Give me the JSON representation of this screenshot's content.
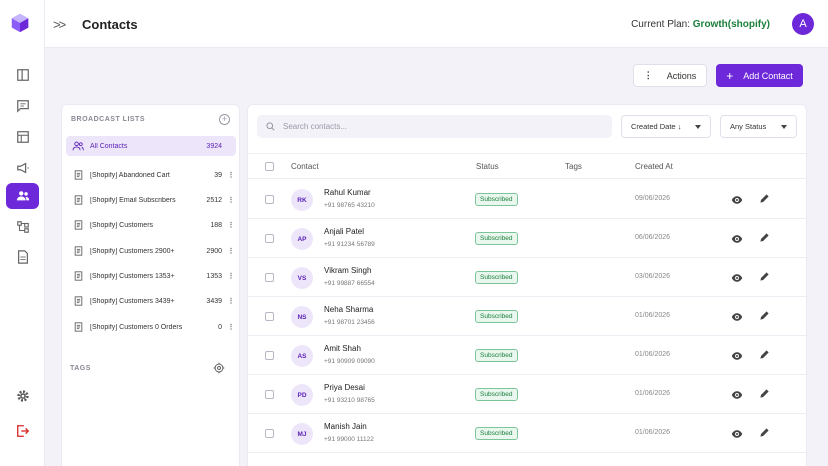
{
  "header": {
    "title": "Contacts",
    "plan_label": "Current Plan:",
    "plan_value": "Growth(shopify)",
    "avatar_initial": "A"
  },
  "toolbar": {
    "actions_label": "Actions",
    "add_contact_label": "Add Contact"
  },
  "sidebar": {
    "broadcast_header": "BROADCAST LISTS",
    "tags_header": "TAGS",
    "lists": [
      {
        "label": "All Contacts",
        "count": "3924",
        "active": true
      },
      {
        "label": "[Shopify] Abandoned Cart",
        "count": "39"
      },
      {
        "label": "[Shopify] Email Subscribers",
        "count": "2512"
      },
      {
        "label": "[Shopify] Customers",
        "count": "188"
      },
      {
        "label": "[Shopify] Customers 2900+",
        "count": "2900"
      },
      {
        "label": "[Shopify] Customers 1353+",
        "count": "1353"
      },
      {
        "label": "[Shopify] Customers 3439+",
        "count": "3439"
      },
      {
        "label": "[Shopify] Customers 0 Orders",
        "count": "0"
      }
    ]
  },
  "filters": {
    "search_placeholder": "Search contacts...",
    "sort_label": "Created Date ↓",
    "status_label": "Any Status"
  },
  "table": {
    "columns": {
      "contact": "Contact",
      "status": "Status",
      "tags": "Tags",
      "created": "Created At"
    },
    "rows": [
      {
        "initials": "RK",
        "name": "Rahul Kumar",
        "phone": "+91 98765 43210",
        "status": "Subscribed",
        "created": "09/06/2026"
      },
      {
        "initials": "AP",
        "name": "Anjali Patel",
        "phone": "+91 91234 56789",
        "status": "Subscribed",
        "created": "06/06/2026"
      },
      {
        "initials": "VS",
        "name": "Vikram Singh",
        "phone": "+91 99887 66554",
        "status": "Subscribed",
        "created": "03/06/2026"
      },
      {
        "initials": "NS",
        "name": "Neha Sharma",
        "phone": "+91 98701 23456",
        "status": "Subscribed",
        "created": "01/06/2026"
      },
      {
        "initials": "AS",
        "name": "Amit Shah",
        "phone": "+91 90909 09090",
        "status": "Subscribed",
        "created": "01/06/2026"
      },
      {
        "initials": "PD",
        "name": "Priya Desai",
        "phone": "+91 93210 98765",
        "status": "Subscribed",
        "created": "01/06/2026"
      },
      {
        "initials": "MJ",
        "name": "Manish Jain",
        "phone": "+91 99000 11122",
        "status": "Subscribed",
        "created": "01/06/2026"
      }
    ]
  },
  "colors": {
    "accent": "#6d28d9",
    "success": "#1b7f3a"
  }
}
